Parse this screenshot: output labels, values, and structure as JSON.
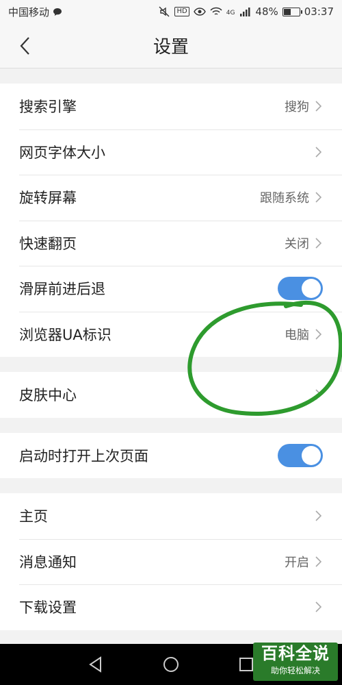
{
  "status_bar": {
    "carrier": "中国移动",
    "signal_label": "4G",
    "battery_percent": "48%",
    "battery_level": 0.48,
    "time": "03:37",
    "hd": "HD"
  },
  "header": {
    "title": "设置"
  },
  "groups": [
    {
      "rows": [
        {
          "label": "搜索引擎",
          "value": "搜狗",
          "kind": "chevron"
        },
        {
          "label": "网页字体大小",
          "value": "",
          "kind": "chevron"
        },
        {
          "label": "旋转屏幕",
          "value": "跟随系统",
          "kind": "chevron"
        },
        {
          "label": "快速翻页",
          "value": "关闭",
          "kind": "chevron"
        },
        {
          "label": "滑屏前进后退",
          "kind": "toggle",
          "on": true
        },
        {
          "label": "浏览器UA标识",
          "value": "电脑",
          "kind": "chevron"
        }
      ]
    },
    {
      "rows": [
        {
          "label": "皮肤中心",
          "value": "",
          "kind": "chevron"
        }
      ]
    },
    {
      "rows": [
        {
          "label": "启动时打开上次页面",
          "kind": "toggle",
          "on": true
        }
      ]
    },
    {
      "rows": [
        {
          "label": "主页",
          "value": "",
          "kind": "chevron"
        },
        {
          "label": "消息通知",
          "value": "开启",
          "kind": "chevron"
        },
        {
          "label": "下载设置",
          "value": "",
          "kind": "chevron"
        }
      ]
    }
  ],
  "watermark": {
    "title": "百科全说",
    "subtitle": "助你轻松解决"
  },
  "colors": {
    "toggle_on": "#4a90e2",
    "annotation": "#2e9b2e",
    "watermark_bg": "#2a7b2a"
  }
}
